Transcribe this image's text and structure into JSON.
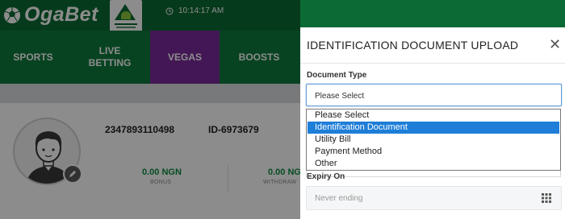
{
  "header": {
    "brand": "OgaBet",
    "time": "10:14:17 AM"
  },
  "nav": {
    "items": [
      {
        "label": "SPORTS"
      },
      {
        "label": "LIVE\nBETTING"
      },
      {
        "label": "VEGAS"
      },
      {
        "label": "BOOSTS"
      }
    ],
    "active_color": "#7a2a9c"
  },
  "profile": {
    "phone": "2347893110498",
    "user_id": "ID-6973679",
    "stats": [
      {
        "value": "0.00 NGN",
        "label": "BONUS"
      },
      {
        "value": "0.00 NG",
        "label": "WITHDRAW"
      }
    ]
  },
  "modal": {
    "title": "IDENTIFICATION DOCUMENT UPLOAD",
    "document_type_label": "Document Type",
    "select_value": "Please Select",
    "options": [
      {
        "label": "Please Select",
        "selected": false
      },
      {
        "label": "Identification Document",
        "selected": true
      },
      {
        "label": "Utility Bill",
        "selected": false
      },
      {
        "label": "Payment Method",
        "selected": false
      },
      {
        "label": "Other",
        "selected": false
      }
    ],
    "expiry_label": "Expiry On",
    "expiry_placeholder": "Never ending"
  },
  "icons": {
    "clock": "clock-icon",
    "close": "close-icon",
    "edit": "edit-icon",
    "calendar": "calendar-icon"
  },
  "colors": {
    "brand_green": "#0c6b34",
    "nav_green": "#0f7a3c",
    "highlight_blue": "#1e7ed8",
    "stat_green": "#0c8a3e"
  }
}
